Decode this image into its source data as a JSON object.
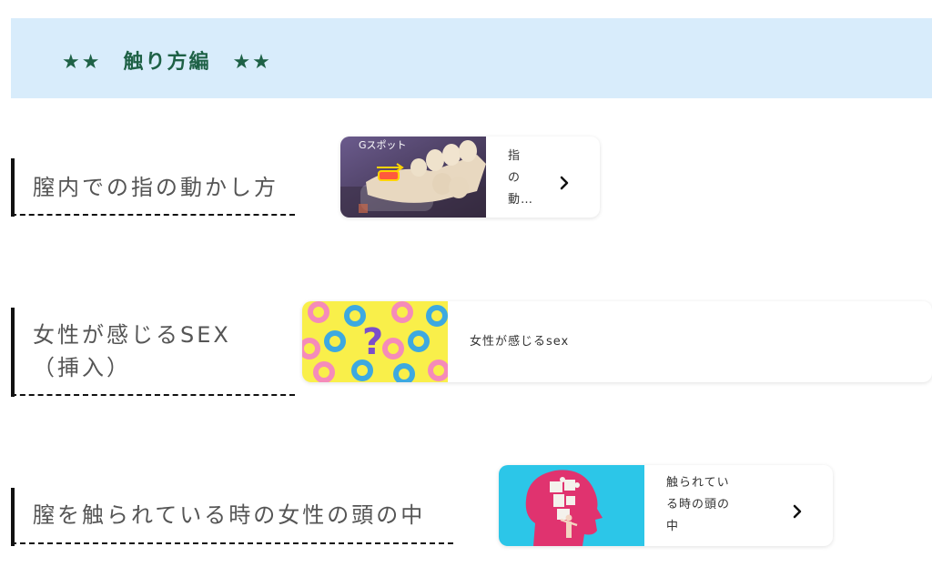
{
  "header": {
    "title": "★★　触り方編　★★"
  },
  "sections": [
    {
      "heading": "膣内での指の動かし方",
      "card": {
        "thumb_caption": "Gスポット",
        "label_lines": [
          "指",
          "の",
          "動…"
        ]
      }
    },
    {
      "heading_lines": [
        "女性が感じるSEX",
        "（挿入）"
      ],
      "card": {
        "label": "女性が感じるsex"
      }
    },
    {
      "heading": "膣を触られている時の女性の頭の中",
      "card": {
        "label_lines": [
          "触られてい",
          "る時の頭の",
          "中"
        ]
      }
    }
  ],
  "colors": {
    "header_band": "#d8ecfb",
    "header_text": "#1e6146",
    "heading_text": "#555555",
    "heading_bar": "#111111"
  },
  "icons": [
    "chevron-right-icon"
  ]
}
